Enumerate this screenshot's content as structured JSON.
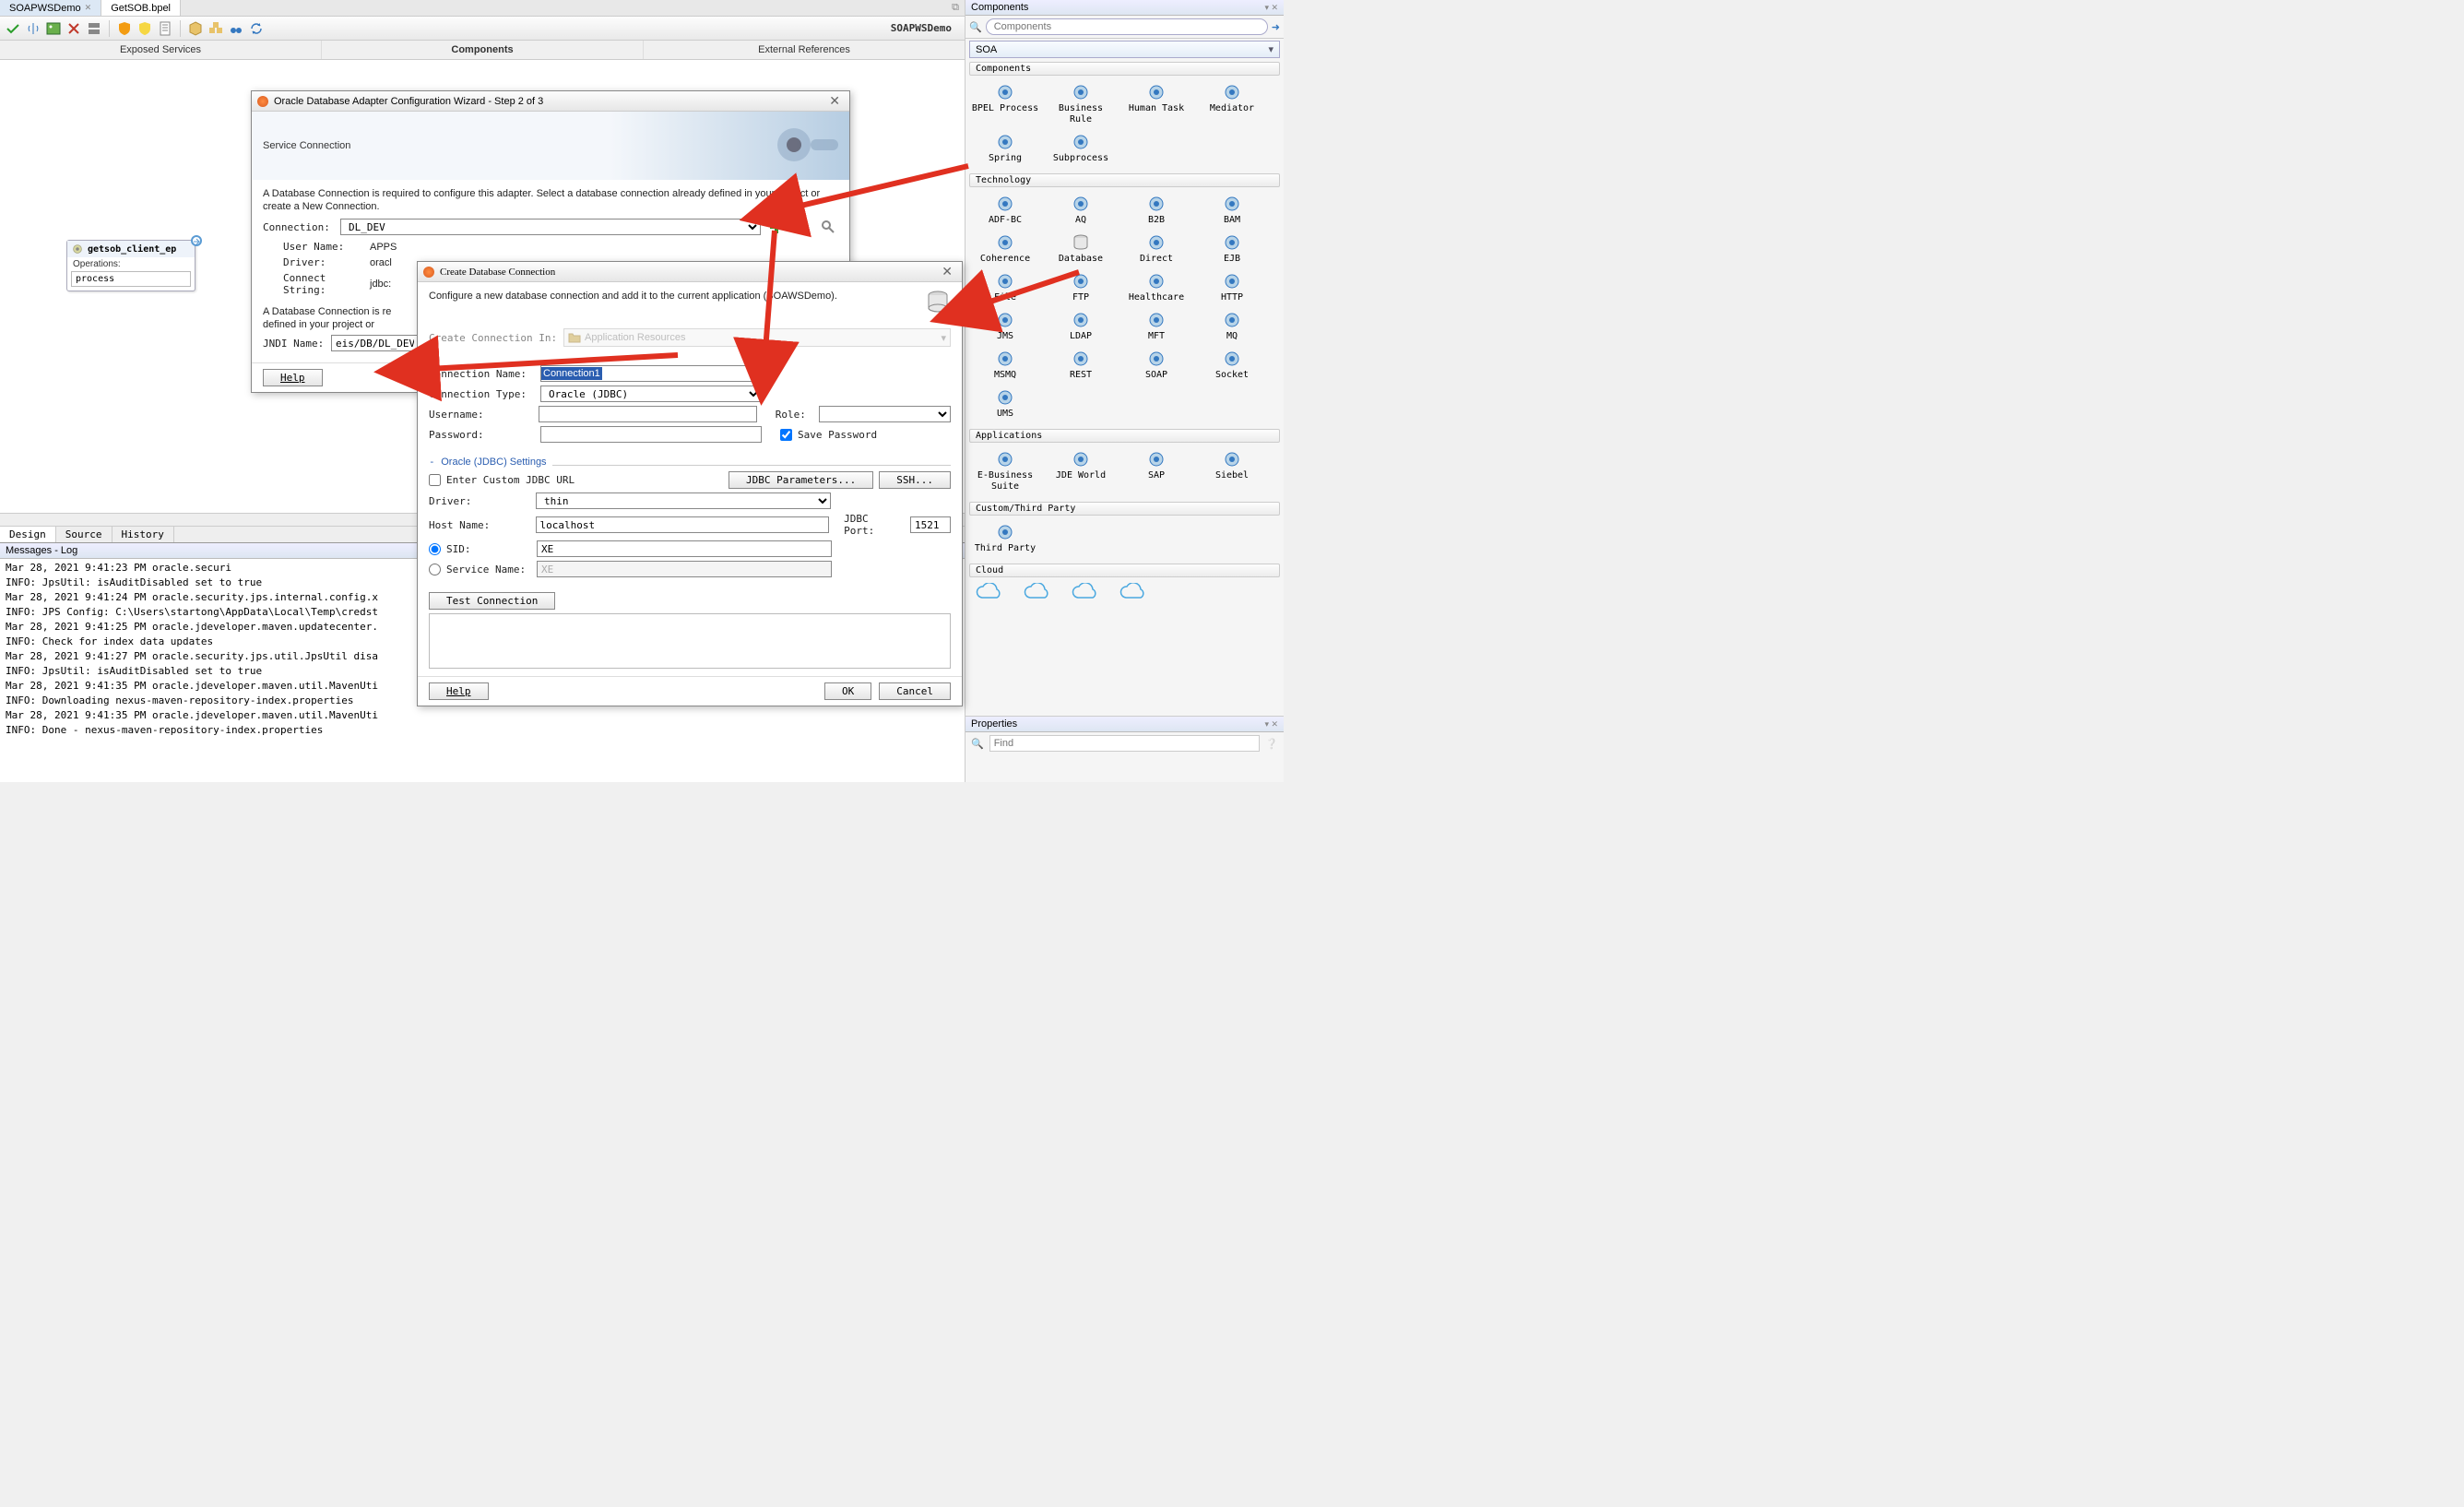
{
  "tabs": {
    "items": [
      {
        "label": "SOAPWSDemo",
        "active": true
      },
      {
        "label": "GetSOB.bpel",
        "active": false
      }
    ]
  },
  "toolbar": {
    "title": "SOAPWSDemo"
  },
  "editor": {
    "columns": [
      "Exposed Services",
      "Components",
      "External References"
    ],
    "bottom_tabs": [
      "Design",
      "Source",
      "History"
    ]
  },
  "service": {
    "name": "getsob_client_ep",
    "ops_label": "Operations:",
    "op": "process"
  },
  "wizard": {
    "title": "Oracle Database Adapter Configuration Wizard - Step 2 of 3",
    "banner": "Service Connection",
    "desc": "A Database Connection is required to configure this adapter. Select a database connection already defined in your project or create a New Connection.",
    "conn_label": "Connection:",
    "conn_value": "DL_DEV",
    "user_label": "User Name:",
    "user_value": "APPS",
    "driver_label": "Driver:",
    "driver_value": "oracl",
    "cs_label": "Connect String:",
    "cs_value": "jdbc:",
    "desc2": "A Database Connection is re\ndefined in your project or",
    "jndi_label": "JNDI Name:",
    "jndi_value": "eis/DB/DL_DEV",
    "help": "Help"
  },
  "conn_dialog": {
    "title": "Create Database Connection",
    "desc": "Configure a new database connection and add it to the current application (SOAWSDemo).",
    "create_in_label": "Create Connection In:",
    "create_in_value": "Application Resources",
    "name_label": "Connection Name:",
    "name_value": "Connection1",
    "type_label": "Connection Type:",
    "type_value": "Oracle (JDBC)",
    "user_label": "Username:",
    "user_value": "",
    "role_label": "Role:",
    "role_value": "",
    "pwd_label": "Password:",
    "pwd_value": "",
    "save_pwd": "Save Password",
    "settings_label": "Oracle (JDBC) Settings",
    "custom_url": "Enter Custom JDBC URL",
    "jdbc_params": "JDBC Parameters...",
    "ssh": "SSH...",
    "driver_label": "Driver:",
    "driver_value": "thin",
    "host_label": "Host Name:",
    "host_value": "localhost",
    "port_label": "JDBC Port:",
    "port_value": "1521",
    "sid_label": "SID:",
    "sid_value": "XE",
    "svc_label": "Service Name:",
    "svc_value": "XE",
    "test": "Test Connection",
    "help": "Help",
    "ok": "OK",
    "cancel": "Cancel"
  },
  "log": {
    "title": "Messages - Log",
    "lines": [
      "Mar 28, 2021 9:41:23 PM oracle.securi",
      "INFO: JpsUtil: isAuditDisabled set to true",
      "Mar 28, 2021 9:41:24 PM oracle.security.jps.internal.config.x",
      "INFO: JPS Config: C:\\Users\\startong\\AppData\\Local\\Temp\\credst",
      "Mar 28, 2021 9:41:25 PM oracle.jdeveloper.maven.updatecenter.",
      "INFO: Check for index data updates",
      "Mar 28, 2021 9:41:27 PM oracle.security.jps.util.JpsUtil disa",
      "INFO: JpsUtil: isAuditDisabled set to true",
      "Mar 28, 2021 9:41:35 PM oracle.jdeveloper.maven.util.MavenUti",
      "INFO: Downloading nexus-maven-repository-index.properties",
      "Mar 28, 2021 9:41:35 PM oracle.jdeveloper.maven.util.MavenUti",
      "INFO: Done - nexus-maven-repository-index.properties"
    ]
  },
  "components_panel": {
    "title": "Components",
    "combo": "SOA",
    "sections": {
      "components": "Components",
      "technology": "Technology",
      "applications": "Applications",
      "custom": "Custom/Third Party",
      "cloud": "Cloud"
    },
    "items": {
      "components": [
        "BPEL Process",
        "Business Rule",
        "Human Task",
        "Mediator",
        "Spring",
        "Subprocess"
      ],
      "technology": [
        "ADF-BC",
        "AQ",
        "B2B",
        "BAM",
        "Coherence",
        "Database",
        "Direct",
        "EJB",
        "File",
        "FTP",
        "Healthcare",
        "HTTP",
        "JMS",
        "LDAP",
        "MFT",
        "MQ",
        "MSMQ",
        "REST",
        "SOAP",
        "Socket",
        "UMS"
      ],
      "applications": [
        "E-Business Suite",
        "JDE World",
        "SAP",
        "Siebel"
      ],
      "custom": [
        "Third Party"
      ]
    }
  },
  "props": {
    "title": "Properties",
    "find": "Find"
  }
}
